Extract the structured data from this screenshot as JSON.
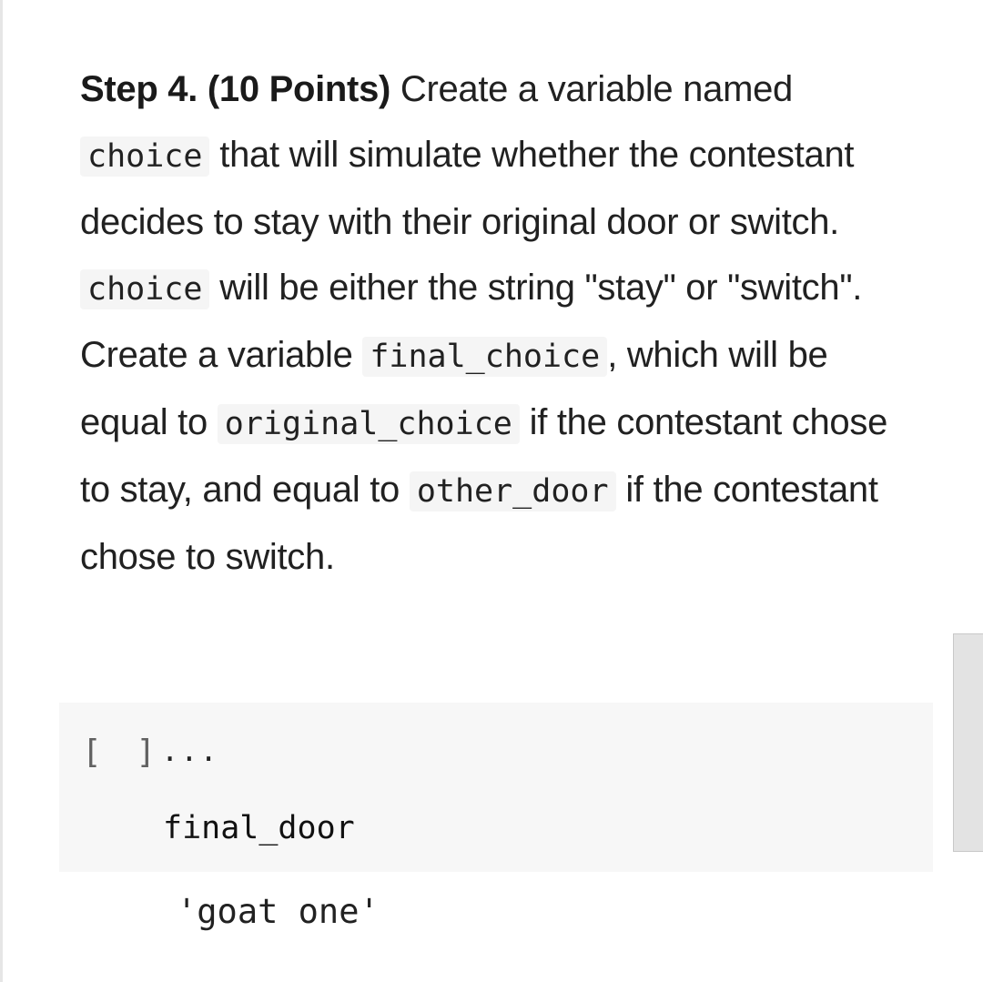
{
  "text_cell": {
    "step_label": "Step 4. (10 Points)",
    "seg1": " Create a variable named ",
    "code1": "choice",
    "seg2": " that will simulate whether the contestant decides to stay with their original door or switch. ",
    "code2": "choice",
    "seg3": " will be either the string \"stay\" or \"switch\". Create a variable ",
    "code3": "final_choice",
    "seg4": ", which will be equal to ",
    "code4": "original_choice",
    "seg5": " if the contestant chose to stay, and equal to ",
    "code5": "other_door",
    "seg6": " if the contestant chose to switch."
  },
  "code_cell": {
    "execution_count": "[ ]",
    "more_menu": "...",
    "source": "final_door",
    "output": "'goat one'"
  }
}
